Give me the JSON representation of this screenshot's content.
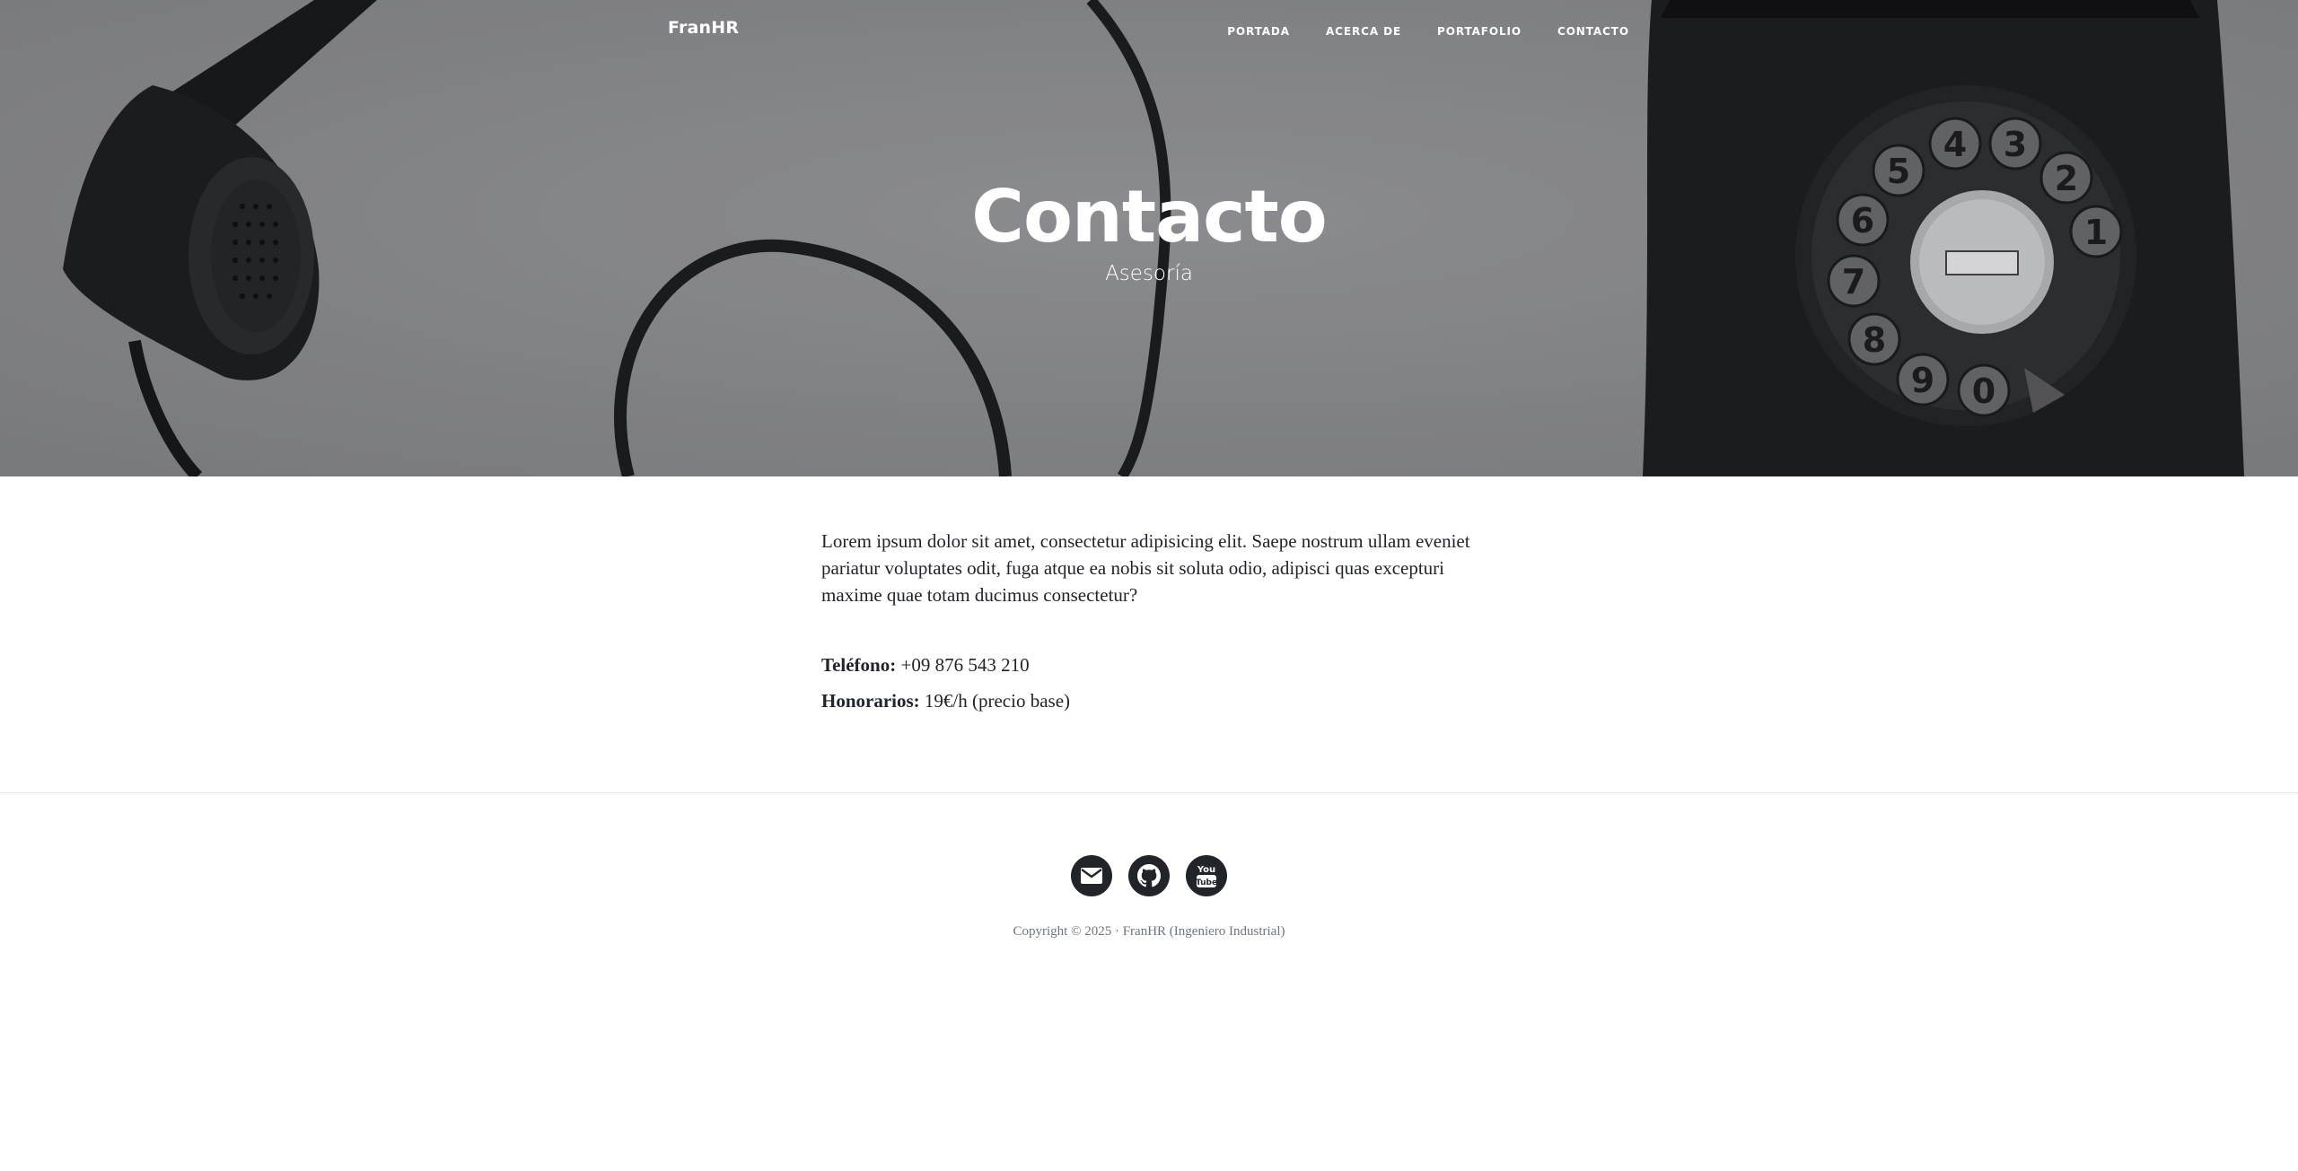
{
  "navbar": {
    "brand": "FranHR",
    "links": [
      {
        "label": "PORTADA"
      },
      {
        "label": "ACERCA DE"
      },
      {
        "label": "PORTAFOLIO"
      },
      {
        "label": "CONTACTO"
      }
    ]
  },
  "hero": {
    "title": "Contacto",
    "subtitle": "Asesoría"
  },
  "main": {
    "intro": "Lorem ipsum dolor sit amet, consectetur adipisicing elit. Saepe nostrum ullam eveniet pariatur voluptates odit, fuga atque ea nobis sit soluta odio, adipisci quas excepturi maxime quae totam ducimus consectetur?",
    "phone_label": "Teléfono:",
    "phone_value": "+09 876 543 210",
    "fees_label": "Honorarios:",
    "fees_value": "19€/h (precio base)"
  },
  "footer": {
    "social_icons": [
      "envelope-icon",
      "github-icon",
      "youtube-icon"
    ],
    "copyright": "Copyright © 2025 · FranHR (Ingeniero Industrial)"
  },
  "colors": {
    "dark": "#212529",
    "muted_text": "#6c757d",
    "hero_gray": "#8f9092"
  }
}
